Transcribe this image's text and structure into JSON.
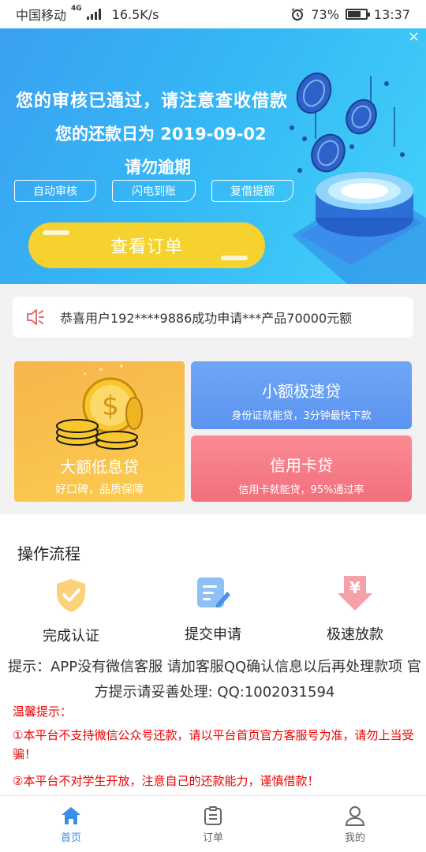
{
  "status_bar": {
    "carrier": "中国移动",
    "network": "4G",
    "speed": "16.5K/s",
    "battery": "73%",
    "battery_level": 0.73,
    "time": "13:37"
  },
  "banner": {
    "line1": "您的审核已通过，请注意查收借款",
    "line2": "您的还款日为 2019-09-02",
    "line3": "请勿逾期",
    "tags": [
      "自动审核",
      "闪电到账",
      "复借提额"
    ],
    "order_button": "查看订单"
  },
  "notice": {
    "icon": "speaker-icon",
    "text": "恭喜用户192****9886成功申请***产品70000元额"
  },
  "products": {
    "big": {
      "title": "大额低息贷",
      "subtitle": "好口碑，品质保障"
    },
    "small": {
      "title": "小额极速贷",
      "subtitle": "身份证就能贷，3分钟最快下款"
    },
    "card": {
      "title": "信用卡贷",
      "subtitle": "信用卡就能贷，95%通过率"
    }
  },
  "process": {
    "title": "操作流程",
    "steps": [
      {
        "label": "完成认证",
        "icon": "shield-check-icon"
      },
      {
        "label": "提交申请",
        "icon": "form-pen-icon"
      },
      {
        "label": "极速放款",
        "icon": "yuan-download-icon"
      }
    ],
    "tip": "提示：APP没有微信客服 请加客服QQ确认信息以后再处理款项 官方提示请妥善处理: QQ:1002031594",
    "warm_title": "温馨提示：",
    "warm_lines": [
      "①本平台不支持微信公众号还款，请以平台首页官方客服号为准，请勿上当受骗！",
      "②本平台不对学生开放，注意自己的还款能力，谨慎借款！"
    ]
  },
  "tabbar": {
    "items": [
      {
        "label": "首页",
        "icon": "home-icon",
        "active": true
      },
      {
        "label": "订单",
        "icon": "order-list-icon",
        "active": false
      },
      {
        "label": "我的",
        "icon": "user-icon",
        "active": false
      }
    ]
  },
  "colors": {
    "accent": "#3a8ee6",
    "banner_gradient": [
      "#3aa0f2",
      "#43d3f9"
    ],
    "order_button": "#f6d22e",
    "warm_text": "#ee0000"
  }
}
